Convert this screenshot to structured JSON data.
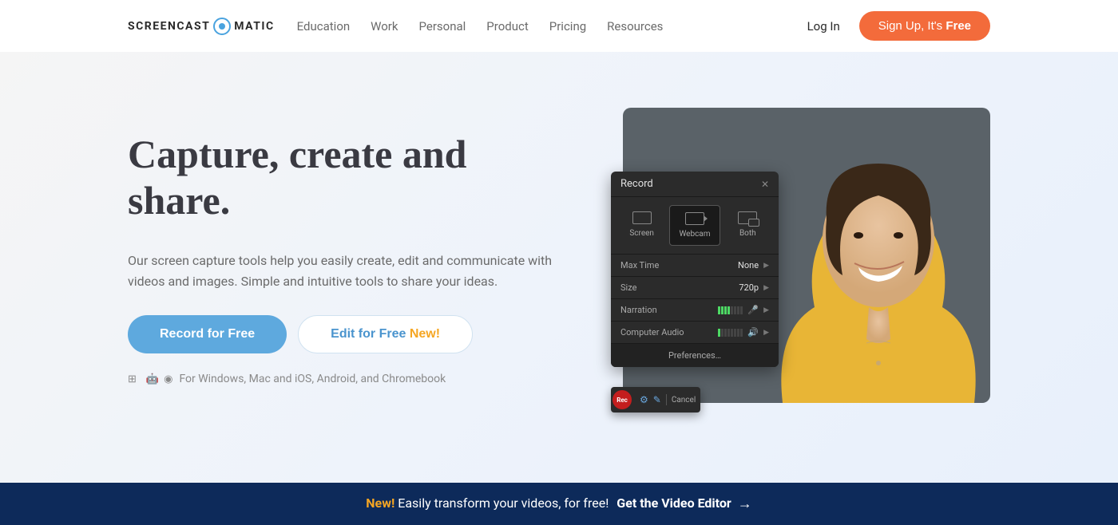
{
  "logo": {
    "part1": "SCREENCAST",
    "part2": "MATIC"
  },
  "nav": {
    "education": "Education",
    "work": "Work",
    "personal": "Personal",
    "product": "Product",
    "pricing": "Pricing",
    "resources": "Resources"
  },
  "auth": {
    "login": "Log In",
    "signup_prefix": "Sign Up, It's ",
    "signup_bold": "Free"
  },
  "hero": {
    "title": "Capture, create and share.",
    "subtitle": "Our screen capture tools help you easily create, edit and communicate with videos and images. Simple and intuitive tools to share your ideas.",
    "btn_record": "Record for Free",
    "btn_edit": "Edit for Free ",
    "btn_edit_new": "New!",
    "platform_caption": "For Windows, Mac and iOS, Android, and Chromebook",
    "platform_icons": {
      "windows": "⊞",
      "apple": "",
      "android": "🤖",
      "chrome": "◉"
    }
  },
  "record_panel": {
    "title": "Record",
    "modes": {
      "screen": "Screen",
      "webcam": "Webcam",
      "both": "Both"
    },
    "settings": {
      "max_time_label": "Max Time",
      "max_time_value": "None",
      "size_label": "Size",
      "size_value": "720p",
      "narration_label": "Narration",
      "computer_audio_label": "Computer Audio"
    },
    "preferences": "Preferences…"
  },
  "rec_toolbar": {
    "rec": "Rec",
    "cancel": "Cancel"
  },
  "banner": {
    "new_tag": "New!",
    "text": " Easily transform your videos, for free!  ",
    "cta": "Get the Video Editor",
    "arrow": "→"
  }
}
